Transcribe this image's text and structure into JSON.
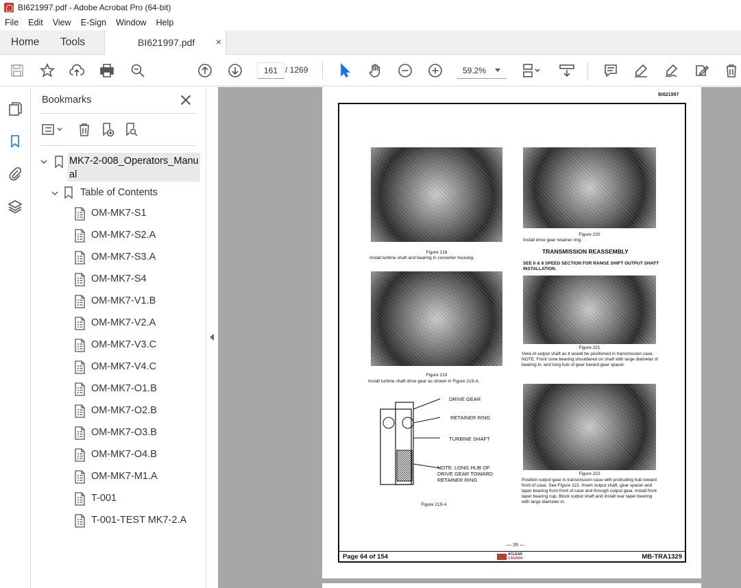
{
  "window": {
    "title": "BI621997.pdf - Adobe Acrobat Pro (64-bit)"
  },
  "menu": [
    "File",
    "Edit",
    "View",
    "E-Sign",
    "Window",
    "Help"
  ],
  "tabs": {
    "home": "Home",
    "tools": "Tools",
    "document": "BI621997.pdf",
    "close": "×"
  },
  "toolbar": {
    "current_page": "161",
    "total_pages": "/  1269",
    "zoom": "59.2%"
  },
  "bookmarks": {
    "title": "Bookmarks",
    "root": "MK7-2-008_Operators_Manual",
    "toc": "Table of Contents",
    "items": [
      "OM-MK7-S1",
      "OM-MK7-S2.A",
      "OM-MK7-S3.A",
      "OM-MK7-S4",
      "OM-MK7-V1.B",
      "OM-MK7-V2.A",
      "OM-MK7-V3.C",
      "OM-MK7-V4.C",
      "OM-MK7-O1.B",
      "OM-MK7-O2.B",
      "OM-MK7-O3.B",
      "OM-MK7-O4.B",
      "OM-MK7-M1.A",
      "T-001",
      "T-001-TEST MK7-2.A"
    ]
  },
  "page": {
    "doc_id": "BI621997",
    "fig218": "Figure 218",
    "fig218_text": "Install turbine shaft and bearing in converter housing.",
    "fig219": "Figure 219",
    "fig219_text": "Install turbine shaft drive gear as shown in Figure 219-A.",
    "fig219a": "Figure 219-A",
    "diag_drive_gear": "DRIVE GEAR",
    "diag_retainer_ring": "RETAINER RING",
    "diag_turbine_shaft": "TURBINE SHAFT",
    "diag_note": "NOTE: LONG HUB OF DRIVE GEAR TOWARD RETAINER RING",
    "fig220": "Figure 220",
    "fig220_text": "Install drive gear retainer ring.",
    "heading": "TRANSMISSION REASSEMBLY",
    "subhead": "SEE 6 & 8 SPEED SECTION FOR RANGE SHIFT OUTPUT SHAFT INSTALLATION.",
    "fig221": "Figure 221",
    "fig221_text": "View of output shaft as it would be positioned in transmission case. NOTE: Front cone bearing shouldered on shaft with large diameter of bearing in, and long hub of gear toward gear spacer.",
    "fig222": "Figure 222",
    "fig222_text": "Position output gear in transmission case with protruding hub toward front of case. See Figure 221. Insert output shaft, gear spacer and taper bearing from front of case and through output gear. Install front taper bearing cup. Block output shaft and install rear taper bearing with large diameter in.",
    "page_number": "— 39 —",
    "footer_left": "Page 64 of 154",
    "footer_right": "MB-TRA1329",
    "logo_top": "ACLEAN",
    "logo_bottom": "CANADA"
  },
  "colors": {
    "accent": "#1473e6",
    "acrobat_red": "#d7322c",
    "canvas": "#a7a7a7"
  }
}
